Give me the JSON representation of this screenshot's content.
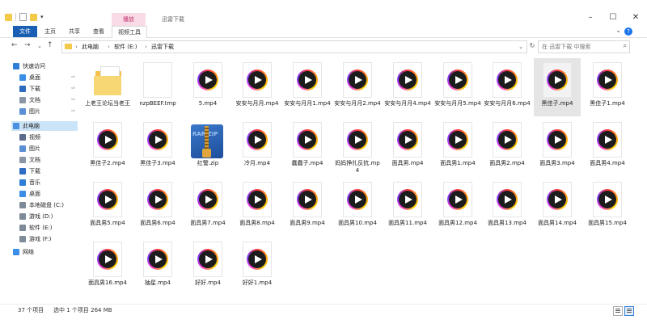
{
  "window": {
    "title": "迅雷下载",
    "context_tab": "播放",
    "minimize": "–",
    "maximize": "☐",
    "close": "✕",
    "quick_access_dropdown": "▾"
  },
  "ribbon": {
    "tabs": [
      "文件",
      "主页",
      "共享",
      "查看",
      "视频工具"
    ],
    "collapse": "⌄",
    "help": "?"
  },
  "address": {
    "back": "←",
    "forward": "→",
    "history": "⌄",
    "up": "↑",
    "crumbs": [
      "此电脑",
      "软件 (E:)",
      "迅雷下载"
    ],
    "separator": "›",
    "dropdown": "⌄",
    "refresh": "↻",
    "search_placeholder": "在 迅雷下载 中搜索",
    "search_icon": "⌕"
  },
  "nav_pane": {
    "items": [
      {
        "label": "快速访问",
        "icon": "star-icon",
        "pinned": false
      },
      {
        "label": "桌面",
        "icon": "desktop-icon",
        "pinned": true
      },
      {
        "label": "下载",
        "icon": "download-icon",
        "pinned": true
      },
      {
        "label": "文档",
        "icon": "documents-icon",
        "pinned": true
      },
      {
        "label": "图片",
        "icon": "pictures-icon",
        "pinned": true
      },
      {
        "label": "此电脑",
        "icon": "computer-icon",
        "pinned": false,
        "selected": true
      },
      {
        "label": "视频",
        "icon": "videos-icon",
        "pinned": false
      },
      {
        "label": "图片",
        "icon": "pictures-icon",
        "pinned": false
      },
      {
        "label": "文档",
        "icon": "documents-icon",
        "pinned": false
      },
      {
        "label": "下载",
        "icon": "download-icon",
        "pinned": false
      },
      {
        "label": "音乐",
        "icon": "music-icon",
        "pinned": false
      },
      {
        "label": "桌面",
        "icon": "desktop-icon",
        "pinned": false
      },
      {
        "label": "本地磁盘 (C:)",
        "icon": "drive-icon",
        "pinned": false
      },
      {
        "label": "游戏 (D:)",
        "icon": "drive-icon",
        "pinned": false
      },
      {
        "label": "软件 (E:)",
        "icon": "drive-icon",
        "pinned": false
      },
      {
        "label": "游戏 (F:)",
        "icon": "drive-icon",
        "pinned": false
      },
      {
        "label": "网络",
        "icon": "network-icon",
        "pinned": false
      }
    ],
    "pin_glyph": "✑"
  },
  "files": [
    {
      "name": "上老王论坛当老王",
      "type": "folder"
    },
    {
      "name": "nzpBEEF.tmp",
      "type": "blank"
    },
    {
      "name": "5.mp4",
      "type": "video"
    },
    {
      "name": "安安与月月.mp4",
      "type": "video"
    },
    {
      "name": "安安与月月1.mp4",
      "type": "video"
    },
    {
      "name": "安安与月月2.mp4",
      "type": "video"
    },
    {
      "name": "安安与月月4.mp4",
      "type": "video"
    },
    {
      "name": "安安与月月5.mp4",
      "type": "video"
    },
    {
      "name": "安安与月月6.mp4",
      "type": "video"
    },
    {
      "name": "黑佳子.mp4",
      "type": "video",
      "selected": true
    },
    {
      "name": "黑佳子1.mp4",
      "type": "video"
    },
    {
      "name": "黑佳子2.mp4",
      "type": "video"
    },
    {
      "name": "黑佳子3.mp4",
      "type": "video"
    },
    {
      "name": "红警.zip",
      "type": "zip",
      "zip_label": "RAR ZIP"
    },
    {
      "name": "冷月.mp4",
      "type": "video"
    },
    {
      "name": "蠢蠢子.mp4",
      "type": "video"
    },
    {
      "name": "妈妈挣扎反抗.mp4",
      "type": "video"
    },
    {
      "name": "面具男.mp4",
      "type": "video"
    },
    {
      "name": "面具男1.mp4",
      "type": "video"
    },
    {
      "name": "面具男2.mp4",
      "type": "video"
    },
    {
      "name": "面具男3.mp4",
      "type": "video"
    },
    {
      "name": "面具男4.mp4",
      "type": "video"
    },
    {
      "name": "面具男5.mp4",
      "type": "video"
    },
    {
      "name": "面具男6.mp4",
      "type": "video"
    },
    {
      "name": "面具男7.mp4",
      "type": "video"
    },
    {
      "name": "面具男8.mp4",
      "type": "video"
    },
    {
      "name": "面具男9.mp4",
      "type": "video"
    },
    {
      "name": "面具男10.mp4",
      "type": "video"
    },
    {
      "name": "面具男11.mp4",
      "type": "video"
    },
    {
      "name": "面具男12.mp4",
      "type": "video"
    },
    {
      "name": "面具男13.mp4",
      "type": "video"
    },
    {
      "name": "面具男14.mp4",
      "type": "video"
    },
    {
      "name": "面具男15.mp4",
      "type": "video"
    },
    {
      "name": "面具男16.mp4",
      "type": "video"
    },
    {
      "name": "抽星.mp4",
      "type": "video"
    },
    {
      "name": "好好.mp4",
      "type": "video"
    },
    {
      "name": "好好1.mp4",
      "type": "video"
    }
  ],
  "status": {
    "count": "37 个项目",
    "selection": "选中 1 个项目  264 MB"
  },
  "colors": {
    "accent": "#1a5fb4",
    "context_tab_bg": "#f8dbe6",
    "context_tab_text": "#c0306b",
    "selection": "#cce4f7",
    "folder": "#f3c94a"
  }
}
